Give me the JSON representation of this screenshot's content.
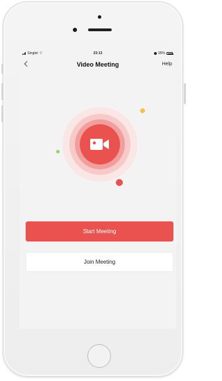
{
  "status_bar": {
    "carrier": "Singtel",
    "time": "23:13",
    "battery": "95%"
  },
  "nav": {
    "title": "Video Meeting",
    "help_label": "Help"
  },
  "actions": {
    "start_label": "Start Meeting",
    "join_label": "Join Meeting"
  },
  "colors": {
    "accent": "#e9524f",
    "accent_light": "#f7c9c9",
    "yellow_dot": "#f2c14e",
    "green_dot": "#8ed36b"
  },
  "icons": [
    "back-icon",
    "video-camera-icon",
    "wifi-icon",
    "signal-icon",
    "battery-icon",
    "alarm-icon"
  ]
}
